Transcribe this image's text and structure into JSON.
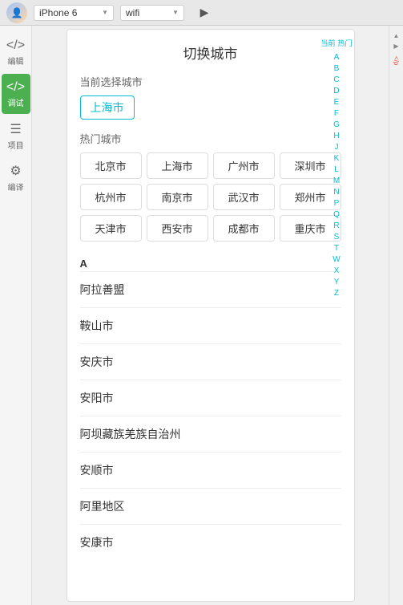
{
  "topbar": {
    "device": "iPhone 6",
    "wifi": "wifi",
    "icon_collapse": "◀"
  },
  "sidebar": {
    "items": [
      {
        "id": "edit",
        "label": "编辑",
        "icon": "</>",
        "active": false
      },
      {
        "id": "debug",
        "label": "调试",
        "icon": "</>",
        "active": true
      },
      {
        "id": "project",
        "label": "项目",
        "icon": "☰",
        "active": false
      },
      {
        "id": "translate",
        "label": "编译",
        "icon": "⚙",
        "active": false
      }
    ]
  },
  "rightpanel": {
    "tag": "</p"
  },
  "page": {
    "title": "切换城市",
    "current_section_label": "当前选择城市",
    "current_city": "上海市",
    "hot_section_label": "热门城市",
    "hot_cities": [
      "北京市",
      "上海市",
      "广州市",
      "深圳市",
      "杭州市",
      "南京市",
      "武汉市",
      "郑州市",
      "天津市",
      "西安市",
      "成都市",
      "重庆市"
    ],
    "alpha_top": [
      "当前",
      "热门"
    ],
    "alpha_list": [
      "A",
      "B",
      "C",
      "D",
      "E",
      "F",
      "G",
      "H",
      "J",
      "K",
      "L",
      "M",
      "N",
      "P",
      "Q",
      "R",
      "S",
      "T",
      "W",
      "X",
      "Y",
      "Z"
    ],
    "city_sections": [
      {
        "letter": "A",
        "cities": [
          "阿拉善盟",
          "鞍山市",
          "安庆市",
          "安阳市",
          "阿坝藏族羌族自治州",
          "安顺市",
          "阿里地区",
          "安康市"
        ]
      }
    ]
  }
}
